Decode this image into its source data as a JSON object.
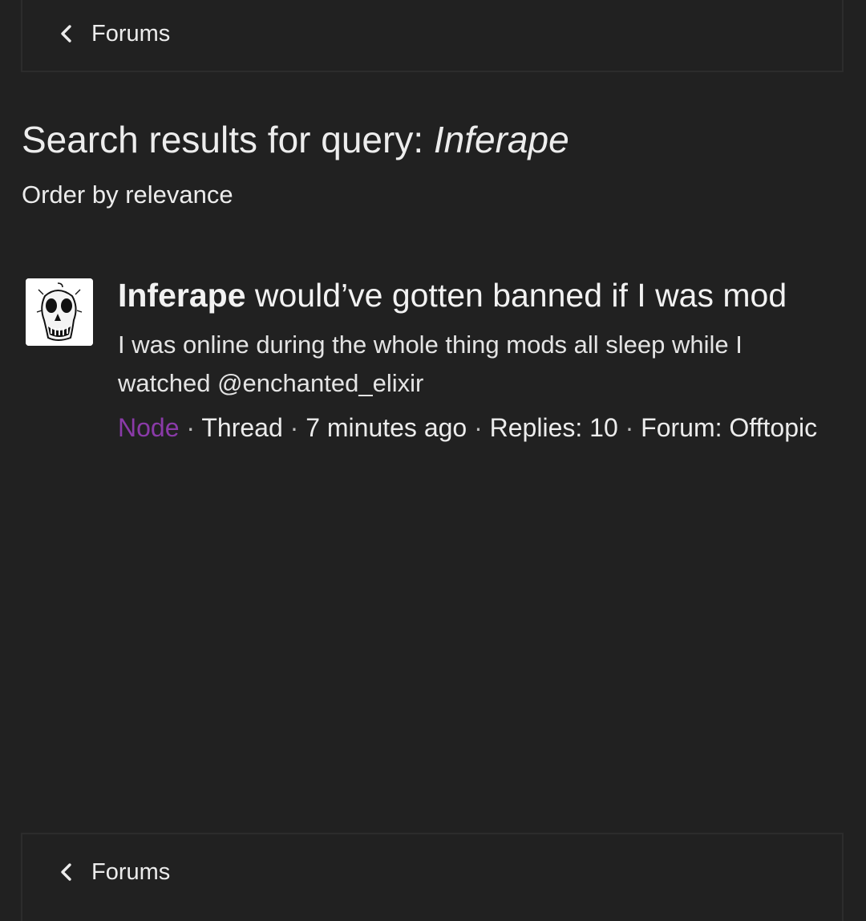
{
  "nav": {
    "back_label": "Forums",
    "back_icon": "chevron-left-icon"
  },
  "search": {
    "title_prefix": "Search results for query: ",
    "query": "Inferape",
    "order_label": "Order by relevance"
  },
  "results": [
    {
      "title_highlight": "Inferape",
      "title_rest": " would’ve gotten banned if I was mod",
      "snippet": "I was online during the whole thing mods all sleep while I watched @enchanted_elixir",
      "author": "Node",
      "type": "Thread",
      "time": "7 minutes ago",
      "replies": "Replies: 10",
      "forum": "Forum: Offtopic",
      "sep": " · "
    }
  ],
  "colors": {
    "background": "#212121",
    "text": "#ececec",
    "author_accent": "#8a3aa8",
    "border": "#2c2c2c"
  }
}
